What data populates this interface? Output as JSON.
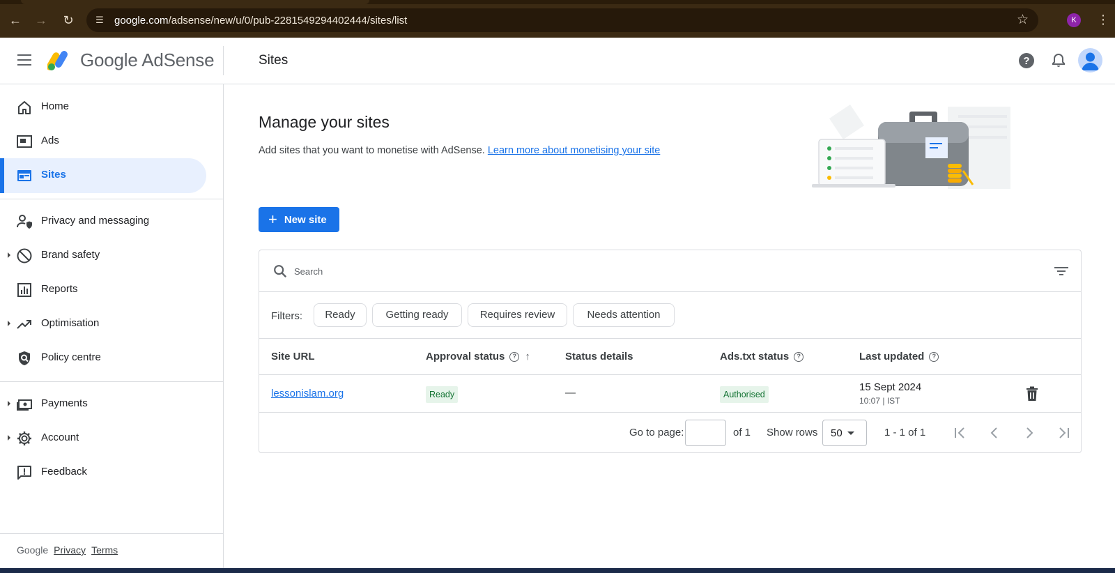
{
  "browser": {
    "url_host": "google.com",
    "url_path": "/adsense/new/u/0/pub-2281549294402444/sites/list",
    "profile_initial": "K"
  },
  "header": {
    "logo_text": "Google AdSense",
    "page_title": "Sites"
  },
  "sidebar": {
    "items": [
      {
        "label": "Home",
        "icon": "home-icon"
      },
      {
        "label": "Ads",
        "icon": "ads-icon"
      },
      {
        "label": "Sites",
        "icon": "sites-icon",
        "active": true
      },
      {
        "label": "Privacy and messaging",
        "icon": "privacy-icon"
      },
      {
        "label": "Brand safety",
        "icon": "block-icon",
        "expandable": true
      },
      {
        "label": "Reports",
        "icon": "reports-icon"
      },
      {
        "label": "Optimisation",
        "icon": "trending-icon",
        "expandable": true
      },
      {
        "label": "Policy centre",
        "icon": "policy-icon"
      },
      {
        "label": "Payments",
        "icon": "payments-icon",
        "expandable": true
      },
      {
        "label": "Account",
        "icon": "gear-icon",
        "expandable": true
      },
      {
        "label": "Feedback",
        "icon": "feedback-icon"
      }
    ],
    "footer": {
      "brand": "Google",
      "privacy": "Privacy",
      "terms": "Terms"
    }
  },
  "main": {
    "heading": "Manage your sites",
    "subtitle": "Add sites that you want to monetise with AdSense.",
    "learn_more": "Learn more about monetising your site",
    "new_site_label": "New site",
    "search": {
      "placeholder": "Search",
      "value": ""
    },
    "filters": {
      "label": "Filters:",
      "chips": [
        "Ready",
        "Getting ready",
        "Requires review",
        "Needs attention"
      ]
    },
    "table": {
      "columns": [
        "Site URL",
        "Approval status",
        "Status details",
        "Ads.txt status",
        "Last updated"
      ],
      "rows": [
        {
          "site_url": "lessonislam.org",
          "approval_status": "Ready",
          "status_details": "—",
          "ads_txt_status": "Authorised",
          "last_updated_date": "15 Sept 2024",
          "last_updated_time": "10:07 | IST"
        }
      ]
    },
    "pagination": {
      "go_to_page_label": "Go to page:",
      "page_value": "",
      "of_pages": "of 1",
      "show_rows_label": "Show rows",
      "rows_value": "50",
      "range": "1 - 1 of 1"
    }
  },
  "colors": {
    "accent": "#1a73e8",
    "active_bg": "#e8f0fe",
    "ready_green": "#137333",
    "ready_bg": "#e6f4ea",
    "browser_frame": "#3b2a13"
  }
}
